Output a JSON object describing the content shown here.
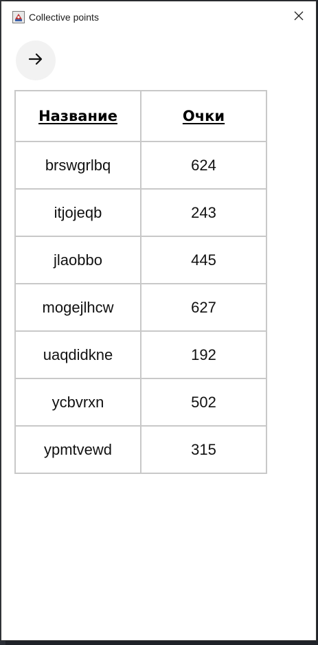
{
  "window": {
    "title": "Collective points"
  },
  "table": {
    "headers": [
      "Название",
      "Очки"
    ],
    "rows": [
      {
        "name": "brswgrlbq",
        "points": "624"
      },
      {
        "name": "itjojeqb",
        "points": "243"
      },
      {
        "name": "jlaobbo",
        "points": "445"
      },
      {
        "name": "mogejlhcw",
        "points": "627"
      },
      {
        "name": "uaqdidkne",
        "points": "192"
      },
      {
        "name": "ycbvrxn",
        "points": "502"
      },
      {
        "name": "ypmtvewd",
        "points": "315"
      }
    ]
  },
  "icons": {
    "app": "java-app-icon",
    "close": "close-icon",
    "back": "arrow-right-icon"
  },
  "colors": {
    "window_bg": "#ffffff",
    "button_bg": "#f2f2f2",
    "table_border": "#c8c8c8"
  }
}
